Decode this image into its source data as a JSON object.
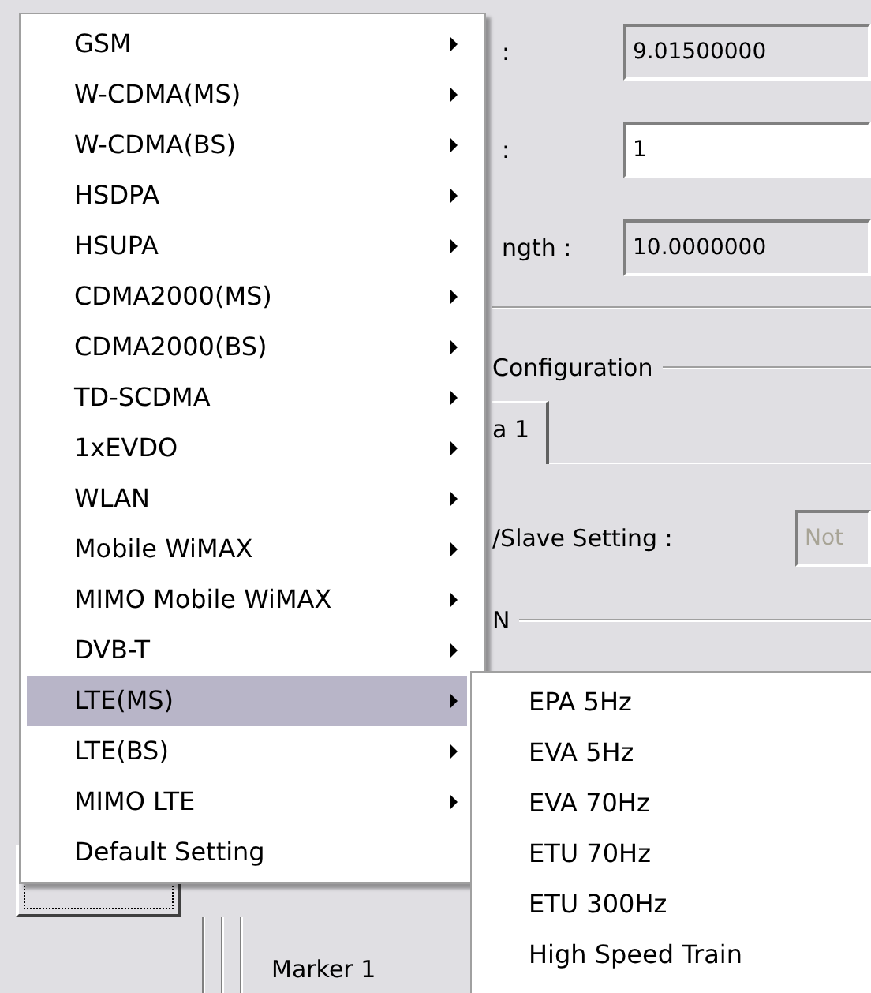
{
  "fields": [
    {
      "label": ":",
      "value": "9.01500000",
      "readonly": true
    },
    {
      "label": ":",
      "value": "1",
      "readonly": false
    },
    {
      "label": "ngth :",
      "value": "10.0000000",
      "readonly": true
    }
  ],
  "group": {
    "title": "Configuration"
  },
  "tabs": [
    {
      "label": "a 1",
      "selected": true
    }
  ],
  "setting": {
    "label": "/Slave Setting :",
    "value": "Not",
    "disabled": true
  },
  "section": {
    "title": "N"
  },
  "marker": {
    "label": "Marker 1"
  },
  "menu": {
    "items": [
      {
        "label": "GSM",
        "submenu": true,
        "selected": false
      },
      {
        "label": "W-CDMA(MS)",
        "submenu": true,
        "selected": false
      },
      {
        "label": "W-CDMA(BS)",
        "submenu": true,
        "selected": false
      },
      {
        "label": "HSDPA",
        "submenu": true,
        "selected": false
      },
      {
        "label": "HSUPA",
        "submenu": true,
        "selected": false
      },
      {
        "label": "CDMA2000(MS)",
        "submenu": true,
        "selected": false
      },
      {
        "label": "CDMA2000(BS)",
        "submenu": true,
        "selected": false
      },
      {
        "label": "TD-SCDMA",
        "submenu": true,
        "selected": false
      },
      {
        "label": "1xEVDO",
        "submenu": true,
        "selected": false
      },
      {
        "label": "WLAN",
        "submenu": true,
        "selected": false
      },
      {
        "label": "Mobile WiMAX",
        "submenu": true,
        "selected": false
      },
      {
        "label": "MIMO Mobile WiMAX",
        "submenu": true,
        "selected": false
      },
      {
        "label": "DVB-T",
        "submenu": true,
        "selected": false
      },
      {
        "label": "LTE(MS)",
        "submenu": true,
        "selected": true
      },
      {
        "label": "LTE(BS)",
        "submenu": true,
        "selected": false
      },
      {
        "label": "MIMO LTE",
        "submenu": true,
        "selected": false
      },
      {
        "label": "Default Setting",
        "submenu": false,
        "selected": false
      }
    ]
  },
  "submenu": {
    "items": [
      {
        "label": "EPA 5Hz"
      },
      {
        "label": "EVA 5Hz"
      },
      {
        "label": "EVA 70Hz"
      },
      {
        "label": "ETU 70Hz"
      },
      {
        "label": "ETU 300Hz"
      },
      {
        "label": "High Speed Train"
      }
    ]
  }
}
